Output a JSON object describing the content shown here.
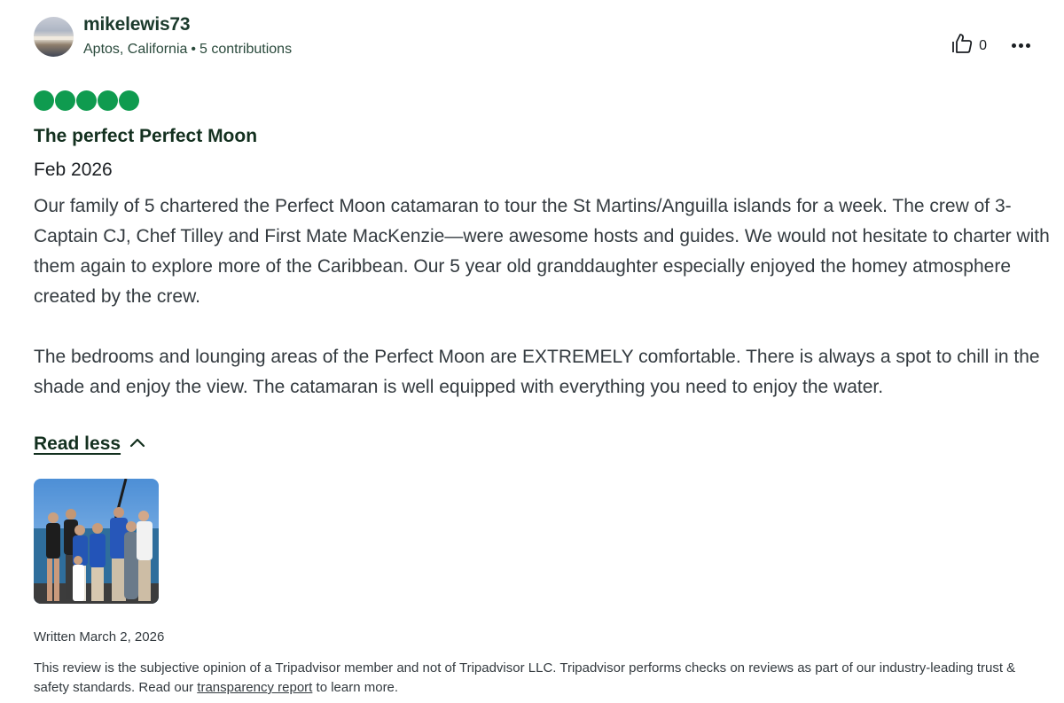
{
  "review": {
    "user": {
      "username": "mikelewis73",
      "location": "Aptos, California",
      "separator": "•",
      "contributions": "5 contributions",
      "avatar_icon": "user-avatar"
    },
    "helpful": {
      "icon": "thumbs-up-icon",
      "count": "0"
    },
    "more_icon": "more-options-icon",
    "rating": {
      "value": 5,
      "max": 5,
      "color": "#0f9b4f"
    },
    "title": "The perfect Perfect Moon",
    "date_of_visit": "Feb 2026",
    "body": [
      "Our family of 5 chartered the Perfect Moon catamaran to tour the St Martins/Anguilla islands for a week. The crew of 3-Captain CJ, Chef Tilley and First Mate MacKenzie—were awesome hosts and guides. We would not hesitate to charter with them again to explore more of the Caribbean. Our 5 year old granddaughter especially enjoyed the homey atmosphere created by the crew.",
      "The bedrooms and lounging areas of the Perfect Moon are EXTREMELY comfortable. There is always a spot to chill in the shade and enjoy the view. The catamaran is well equipped with everything you need to enjoy the water."
    ],
    "read_less_label": "Read less",
    "read_less_icon": "chevron-up-icon",
    "photo_icon": "review-photo",
    "written_date": "Written March 2, 2026",
    "disclaimer": {
      "text_before": "This review is the subjective opinion of a Tripadvisor member and not of Tripadvisor LLC. Tripadvisor performs checks on reviews as part of our industry-leading trust & safety standards. Read our ",
      "link": "transparency report",
      "text_after": " to learn more."
    }
  }
}
